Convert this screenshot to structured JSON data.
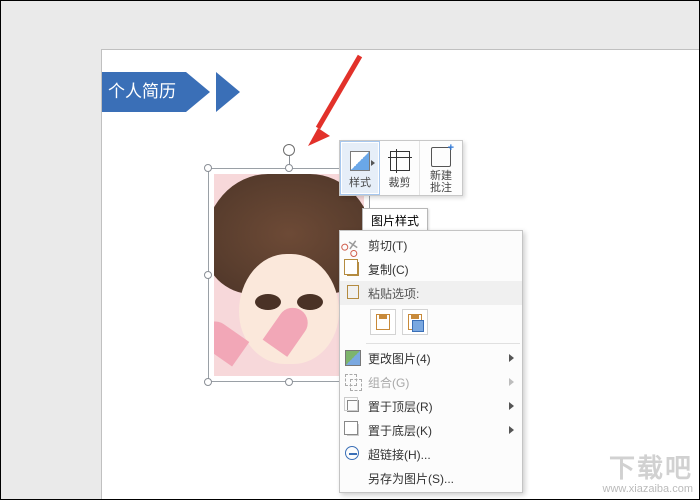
{
  "banner": {
    "title": "个人简历"
  },
  "mini_toolbar": {
    "items": [
      {
        "label": "样式",
        "icon": "style-icon"
      },
      {
        "label": "裁剪",
        "icon": "crop-icon"
      },
      {
        "label_line1": "新建",
        "label_line2": "批注",
        "icon": "comment-icon"
      }
    ],
    "tooltip": "图片样式"
  },
  "context_menu": {
    "cut": "剪切(T)",
    "copy": "复制(C)",
    "paste_header": "粘贴选项:",
    "change": "更改图片(4)",
    "group": "组合(G)",
    "front": "置于顶层(R)",
    "back": "置于底层(K)",
    "link": "超链接(H)...",
    "saveas": "另存为图片(S)..."
  },
  "arrow": {
    "color": "#e2312a"
  },
  "watermark": {
    "brand": "下载吧",
    "url": "www.xiazaiba.com"
  }
}
